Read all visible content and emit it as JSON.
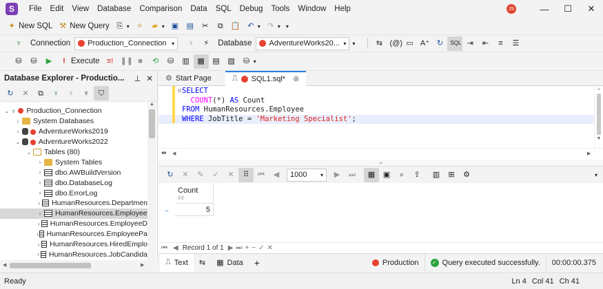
{
  "menu": [
    "File",
    "Edit",
    "View",
    "Database",
    "Comparison",
    "Data",
    "SQL",
    "Debug",
    "Tools",
    "Window",
    "Help"
  ],
  "user_initials": "JS",
  "toolbar1": {
    "new_sql": "New SQL",
    "new_query": "New Query"
  },
  "toolbar2": {
    "connection_label": "Connection",
    "connection_value": "Production_Connection",
    "database_label": "Database",
    "database_value": "AdventureWorks20..."
  },
  "toolbar3": {
    "execute": "Execute"
  },
  "explorer": {
    "title": "Database Explorer - Productio...",
    "tree": [
      {
        "label": "Production_Connection",
        "level": 0,
        "icon": "connection",
        "expanded": true
      },
      {
        "label": "System Databases",
        "level": 1,
        "icon": "folder",
        "expanded": false
      },
      {
        "label": "AdventureWorks2019",
        "level": 1,
        "icon": "database",
        "expanded": false
      },
      {
        "label": "AdventureWorks2022",
        "level": 1,
        "icon": "database",
        "expanded": true
      },
      {
        "label": "Tables (80)",
        "level": 2,
        "icon": "folder-open",
        "expanded": true
      },
      {
        "label": "System Tables",
        "level": 3,
        "icon": "folder",
        "expanded": false
      },
      {
        "label": "dbo.AWBuildVersion",
        "level": 3,
        "icon": "table",
        "expanded": false
      },
      {
        "label": "dbo.DatabaseLog",
        "level": 3,
        "icon": "table",
        "expanded": false
      },
      {
        "label": "dbo.ErrorLog",
        "level": 3,
        "icon": "table",
        "expanded": false
      },
      {
        "label": "HumanResources.Departmen",
        "level": 3,
        "icon": "table",
        "expanded": false
      },
      {
        "label": "HumanResources.Employee",
        "level": 3,
        "icon": "table",
        "expanded": false,
        "selected": true
      },
      {
        "label": "HumanResources.EmployeeD",
        "level": 3,
        "icon": "table",
        "expanded": false
      },
      {
        "label": "HumanResources.EmployeePa",
        "level": 3,
        "icon": "table",
        "expanded": false
      },
      {
        "label": "HumanResources.HiredEmplo",
        "level": 3,
        "icon": "table",
        "expanded": false
      },
      {
        "label": "HumanResources.JobCandida",
        "level": 3,
        "icon": "table",
        "expanded": false
      }
    ]
  },
  "tabs": [
    {
      "label": "Start Page",
      "active": false
    },
    {
      "label": "SQL1.sql*",
      "active": true
    }
  ],
  "editor": {
    "lines": [
      [
        [
          "kw",
          "SELECT"
        ]
      ],
      [
        [
          "",
          "  "
        ],
        [
          "fn",
          "COUNT"
        ],
        [
          "",
          "(*) "
        ],
        [
          "kw",
          "AS"
        ],
        [
          "",
          " Count"
        ]
      ],
      [
        [
          "kw",
          "FROM"
        ],
        [
          "",
          " HumanResources.Employee"
        ]
      ],
      [
        [
          "kw",
          "WHERE"
        ],
        [
          "",
          " JobTitle = "
        ],
        [
          "str",
          "'Marketing Specialist'"
        ],
        [
          "",
          ";"
        ]
      ]
    ]
  },
  "results": {
    "page_size": "1000",
    "column_header": "Count",
    "column_type": "int",
    "row_value": "5",
    "record_text": "Record 1 of 1"
  },
  "bottom": {
    "text_tab": "Text",
    "data_tab": "Data",
    "connection": "Production",
    "status": "Query executed successfully.",
    "elapsed": "00:00:00.375"
  },
  "statusbar": {
    "ready": "Ready",
    "ln": "Ln 4",
    "col": "Col 41",
    "ch": "Ch 41"
  }
}
